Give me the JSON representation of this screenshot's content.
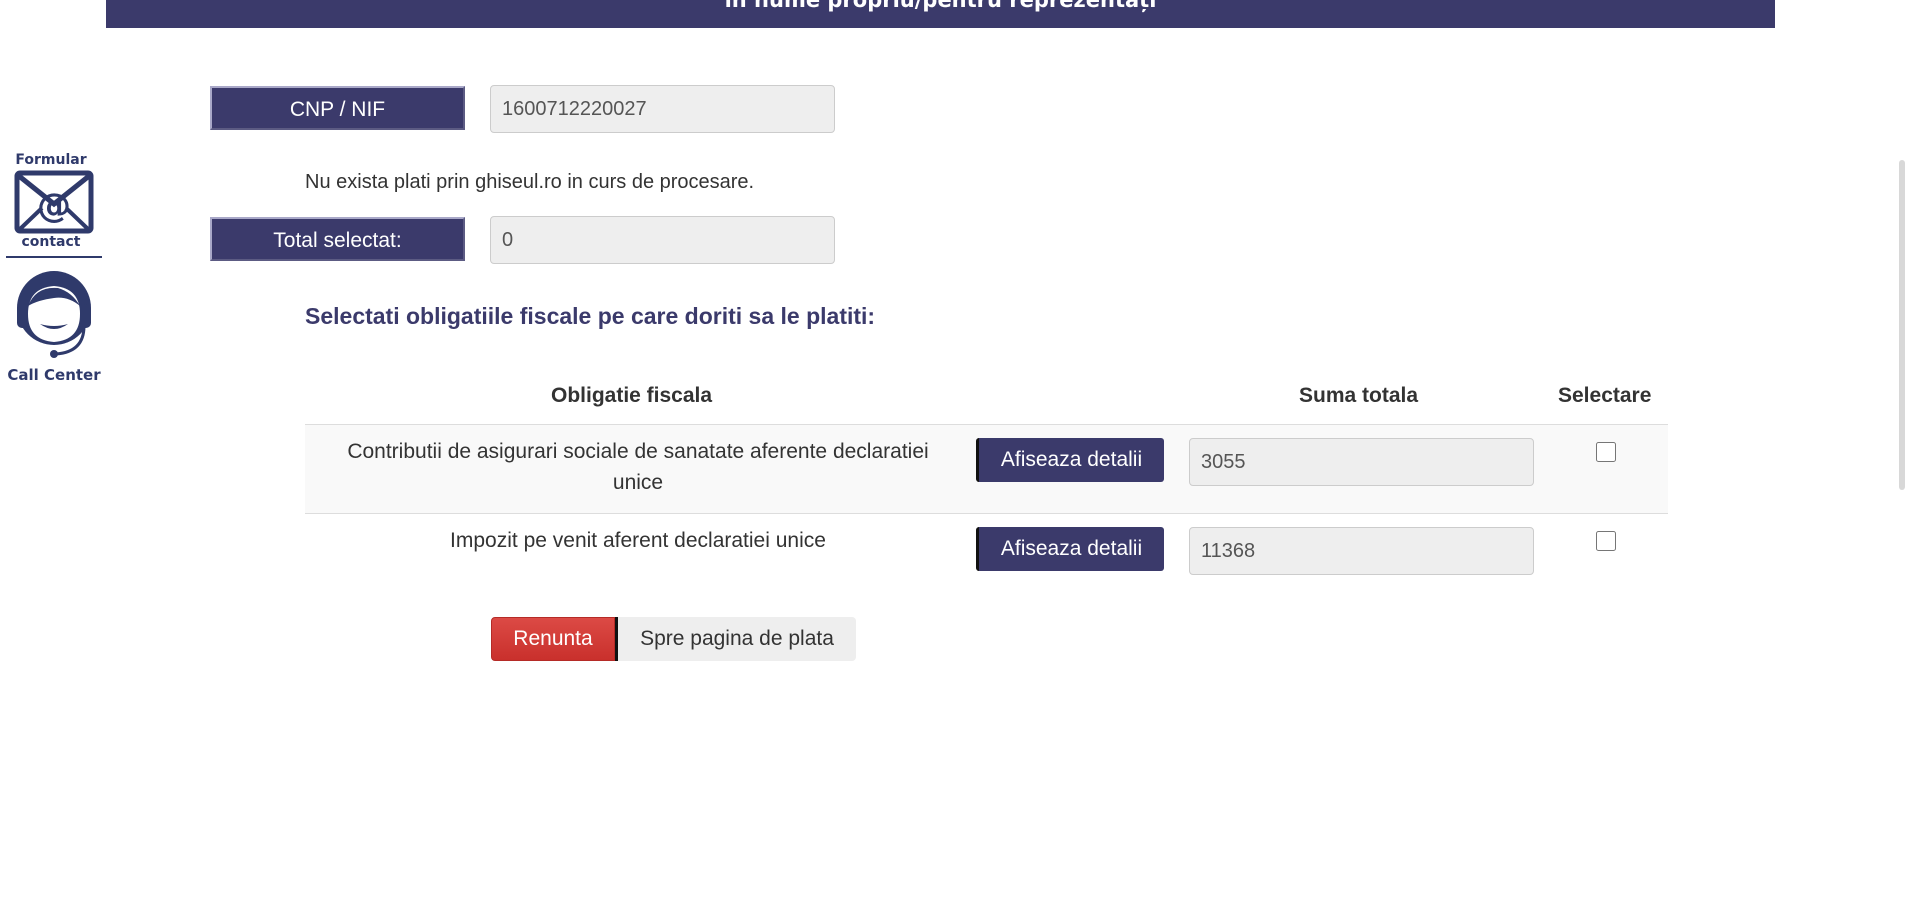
{
  "header": {
    "banner_text": "în nume propriu/pentru reprezentați"
  },
  "side": {
    "form_label_top": "Formular",
    "form_label_bottom": "contact",
    "callcenter_label": "Call Center"
  },
  "form": {
    "cnp_label": "CNP / NIF",
    "cnp_value": "1600712220027",
    "info_message": "Nu exista plati prin ghiseul.ro in curs de procesare.",
    "total_label": "Total selectat:",
    "total_value": "0"
  },
  "obligations": {
    "heading": "Selectati obligatiile fiscale pe care doriti sa le platiti:",
    "columns": {
      "obligatie": "Obligatie fiscala",
      "suma": "Suma totala",
      "selectare": "Selectare"
    },
    "rows": [
      {
        "description": "Contributii de asigurari sociale de sanatate aferente declaratiei unice",
        "details_label": "Afiseaza detalii",
        "amount": "3055",
        "selected": false
      },
      {
        "description": "Impozit pe venit aferent declaratiei unice",
        "details_label": "Afiseaza detalii",
        "amount": "11368",
        "selected": false
      }
    ]
  },
  "actions": {
    "cancel_label": "Renunta",
    "proceed_label": "Spre pagina de plata"
  },
  "colors": {
    "brand": "#3b3a6b",
    "danger": "#d9534f"
  }
}
